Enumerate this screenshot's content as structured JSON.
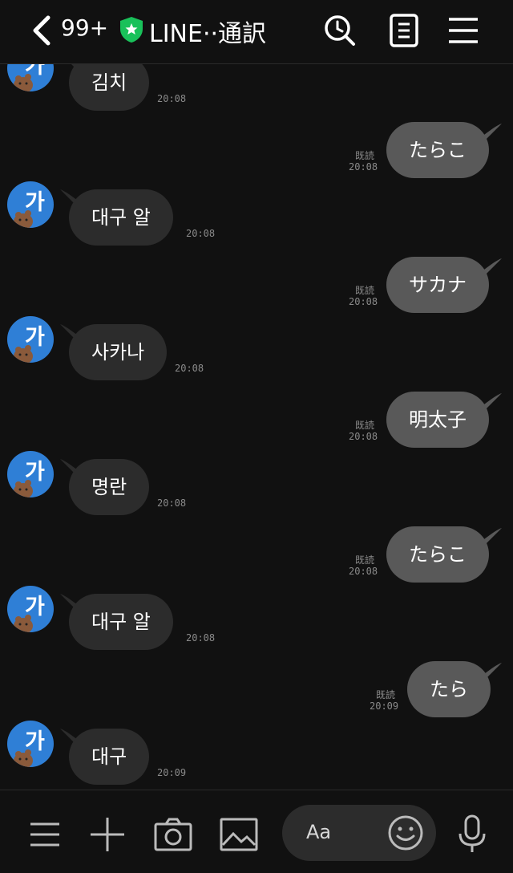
{
  "header": {
    "unread_count": "99+",
    "title": "LINE··通訳",
    "back_icon": "chevron-left-icon",
    "verified_icon": "shield-star-icon",
    "actions": [
      "search-icon",
      "notes-icon",
      "menu-icon"
    ]
  },
  "colors": {
    "background": "#111111",
    "incoming_bubble": "#2c2c2c",
    "outgoing_bubble": "#595959",
    "avatar": "#2f7fd6",
    "verified_green": "#19c15a"
  },
  "contact": {
    "avatar_text": "가"
  },
  "messages": [
    {
      "direction": "in",
      "text": "김치",
      "time": "20:08"
    },
    {
      "direction": "out",
      "text": "たらこ",
      "read": "既読",
      "time": "20:08"
    },
    {
      "direction": "in",
      "text": "대구 알",
      "time": "20:08"
    },
    {
      "direction": "out",
      "text": "サカナ",
      "read": "既読",
      "time": "20:08"
    },
    {
      "direction": "in",
      "text": "사카나",
      "time": "20:08"
    },
    {
      "direction": "out",
      "text": "明太子",
      "read": "既読",
      "time": "20:08"
    },
    {
      "direction": "in",
      "text": "명란",
      "time": "20:08"
    },
    {
      "direction": "out",
      "text": "たらこ",
      "read": "既読",
      "time": "20:08"
    },
    {
      "direction": "in",
      "text": "대구 알",
      "time": "20:08"
    },
    {
      "direction": "out",
      "text": "たら",
      "read": "既読",
      "time": "20:09"
    },
    {
      "direction": "in",
      "text": "대구",
      "time": "20:09"
    }
  ],
  "composer": {
    "placeholder": "Aa",
    "icons": [
      "menu-icon",
      "plus-icon",
      "camera-icon",
      "image-icon",
      "emoji-icon",
      "microphone-icon"
    ]
  }
}
